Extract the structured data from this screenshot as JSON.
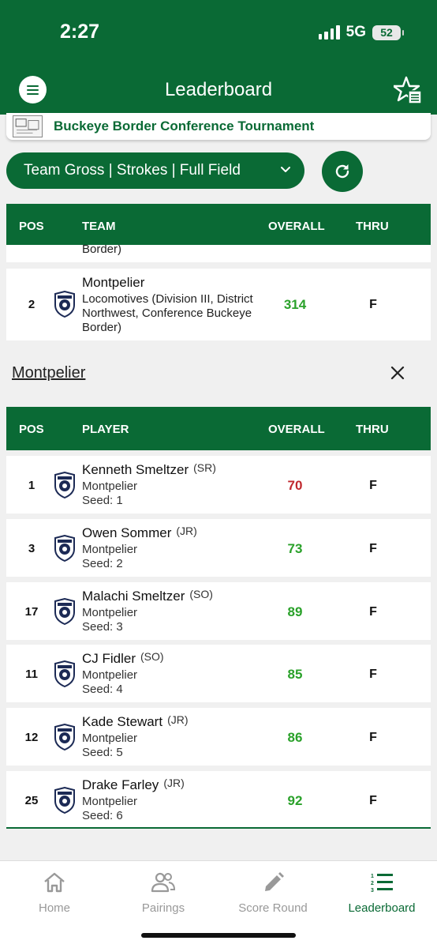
{
  "status_bar": {
    "time": "2:27",
    "network": "5G",
    "battery": "52"
  },
  "header": {
    "title": "Leaderboard"
  },
  "tournament": {
    "name": "Buckeye Border Conference Tournament"
  },
  "filter": {
    "label": "Team Gross | Strokes | Full Field"
  },
  "team_table": {
    "columns": {
      "pos": "POS",
      "name": "TEAM",
      "overall": "OVERALL",
      "thru": "THRU"
    },
    "partial_row_text": "Border)",
    "rows": [
      {
        "pos": "2",
        "name": "Montpelier",
        "detail": "Locomotives (Division III, District Northwest, Conference Buckeye Border)",
        "overall": "314",
        "thru": "F"
      }
    ]
  },
  "section": {
    "team_link": "Montpelier"
  },
  "player_table": {
    "columns": {
      "pos": "POS",
      "name": "PLAYER",
      "overall": "OVERALL",
      "thru": "THRU"
    },
    "rows": [
      {
        "pos": "1",
        "name": "Kenneth Smeltzer",
        "grade": "(SR)",
        "team": "Montpelier",
        "seed": "Seed: 1",
        "overall": "70",
        "thru": "F",
        "under_par": true
      },
      {
        "pos": "3",
        "name": "Owen Sommer",
        "grade": "(JR)",
        "team": "Montpelier",
        "seed": "Seed: 2",
        "overall": "73",
        "thru": "F",
        "under_par": false
      },
      {
        "pos": "17",
        "name": "Malachi Smeltzer",
        "grade": "(SO)",
        "team": "Montpelier",
        "seed": "Seed: 3",
        "overall": "89",
        "thru": "F",
        "under_par": false
      },
      {
        "pos": "11",
        "name": "CJ Fidler",
        "grade": "(SO)",
        "team": "Montpelier",
        "seed": "Seed: 4",
        "overall": "85",
        "thru": "F",
        "under_par": false
      },
      {
        "pos": "12",
        "name": "Kade Stewart",
        "grade": "(JR)",
        "team": "Montpelier",
        "seed": "Seed: 5",
        "overall": "86",
        "thru": "F",
        "under_par": false
      },
      {
        "pos": "25",
        "name": "Drake Farley",
        "grade": "(JR)",
        "team": "Montpelier",
        "seed": "Seed: 6",
        "overall": "92",
        "thru": "F",
        "under_par": false
      }
    ]
  },
  "tabbar": {
    "tabs": [
      {
        "label": "Home",
        "icon": "home-icon"
      },
      {
        "label": "Pairings",
        "icon": "people-icon"
      },
      {
        "label": "Score Round",
        "icon": "pencil-icon"
      },
      {
        "label": "Leaderboard",
        "icon": "ranked-list-icon"
      }
    ],
    "active_index": 3
  },
  "colors": {
    "brand": "#0a6a35",
    "score_green": "#2aa12a",
    "score_red": "#c0282e",
    "inactive": "#999999"
  }
}
